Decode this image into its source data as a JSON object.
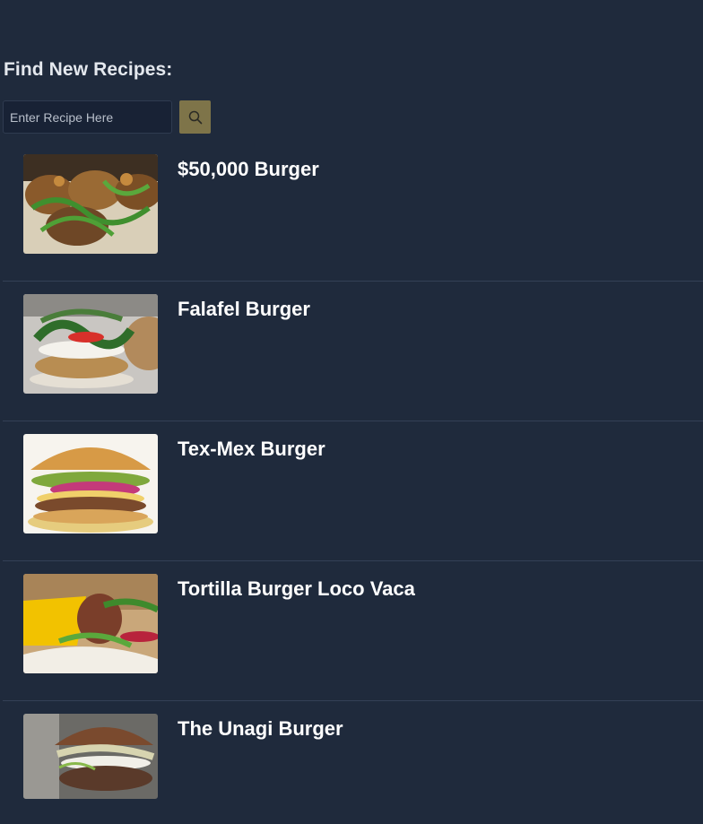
{
  "header": {
    "title": "Find New Recipes:"
  },
  "search": {
    "placeholder": "Enter Recipe Here",
    "value": "",
    "button_icon": "search-icon",
    "button_color": "#7e7449"
  },
  "recipes": [
    {
      "title": "$50,000 Burger",
      "image": "burger-with-arugula-photo"
    },
    {
      "title": "Falafel Burger",
      "image": "falafel-burger-photo"
    },
    {
      "title": "Tex-Mex Burger",
      "image": "tex-mex-burger-photo"
    },
    {
      "title": "Tortilla Burger Loco Vaca",
      "image": "tortilla-burger-photo"
    },
    {
      "title": "The Unagi Burger",
      "image": "unagi-burger-photo"
    }
  ],
  "colors": {
    "background": "#1f2a3c",
    "divider": "#344056",
    "input_background": "#182235"
  }
}
